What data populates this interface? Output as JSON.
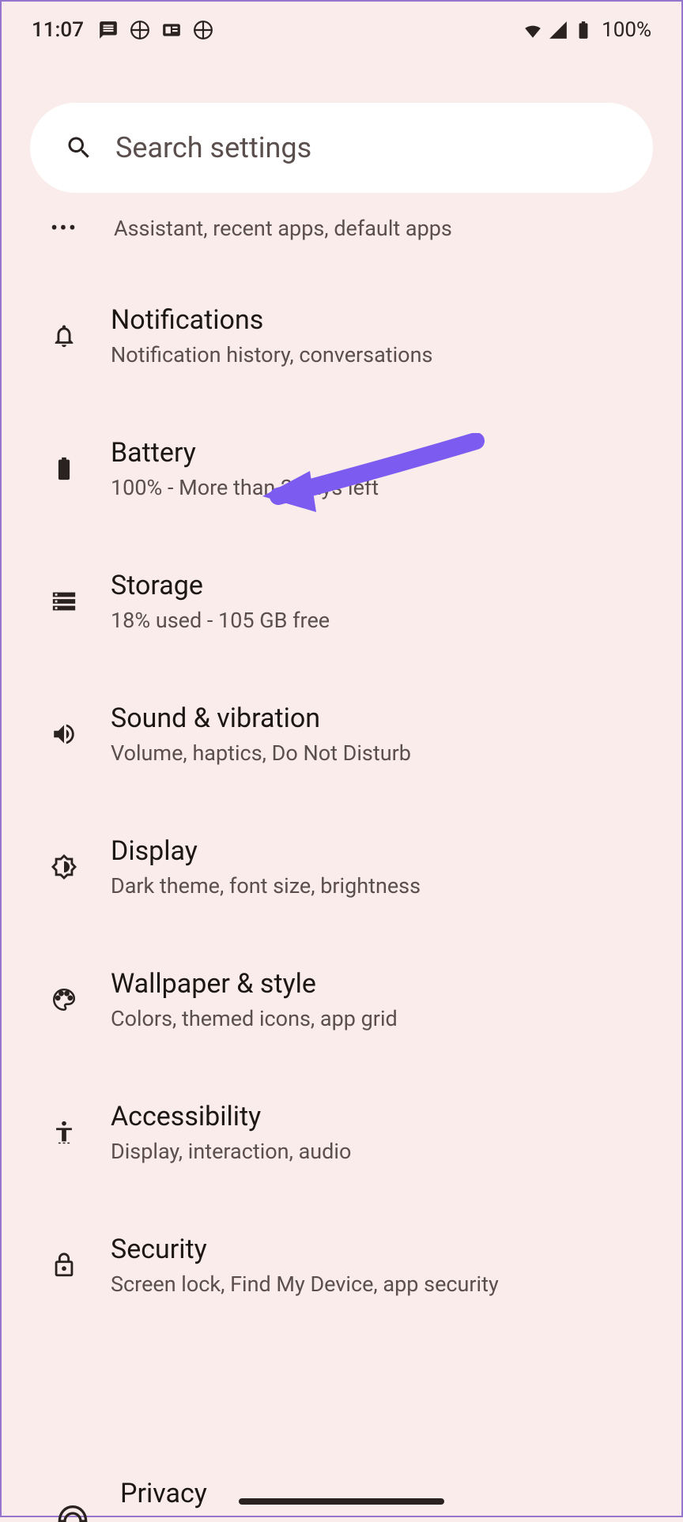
{
  "status": {
    "time": "11:07",
    "battery": "100%"
  },
  "search": {
    "placeholder": "Search settings"
  },
  "partial_top": {
    "subtitle": "Assistant, recent apps, default apps"
  },
  "items": [
    {
      "title": "Notifications",
      "subtitle": "Notification history, conversations"
    },
    {
      "title": "Battery",
      "subtitle": "100% - More than 2 days left"
    },
    {
      "title": "Storage",
      "subtitle": "18% used - 105 GB free"
    },
    {
      "title": "Sound & vibration",
      "subtitle": "Volume, haptics, Do Not Disturb"
    },
    {
      "title": "Display",
      "subtitle": "Dark theme, font size, brightness"
    },
    {
      "title": "Wallpaper & style",
      "subtitle": "Colors, themed icons, app grid"
    },
    {
      "title": "Accessibility",
      "subtitle": "Display, interaction, audio"
    },
    {
      "title": "Security",
      "subtitle": "Screen lock, Find My Device, app security"
    }
  ],
  "partial_bottom": {
    "title": "Privacy"
  },
  "annotation": {
    "arrow_color": "#7c5cf0"
  }
}
